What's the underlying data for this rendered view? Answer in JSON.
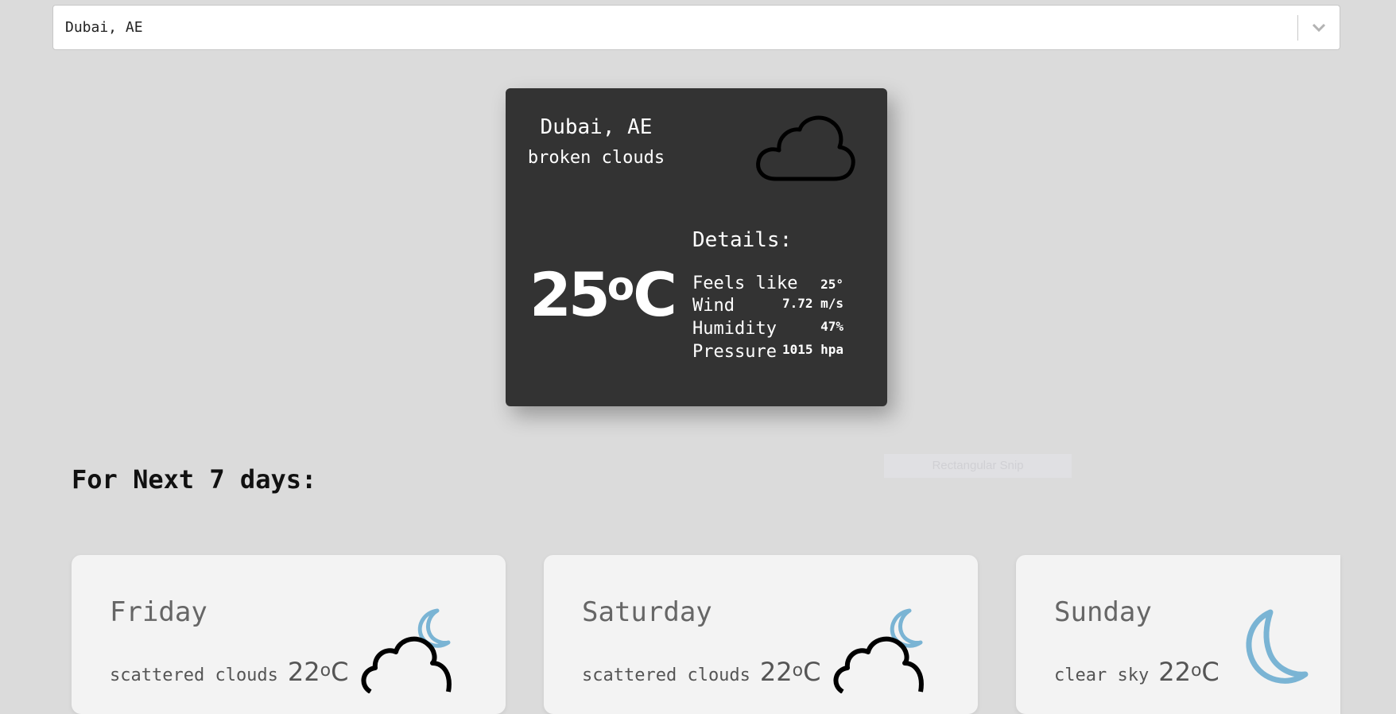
{
  "search": {
    "value": "Dubai, AE"
  },
  "current": {
    "city": "Dubai, AE",
    "description": "broken clouds",
    "temperature": "25",
    "temp_degree": "o",
    "temp_unit": "C",
    "icon": "cloud-icon",
    "details_title": "Details:",
    "details": [
      {
        "label": "Feels like",
        "value": "25°"
      },
      {
        "label": "Wind",
        "value": "7.72 m/s"
      },
      {
        "label": "Humidity",
        "value": "47%"
      },
      {
        "label": "Pressure",
        "value": "1015 hpa"
      }
    ]
  },
  "forecast": {
    "title": "For Next 7 days:",
    "days": [
      {
        "day": "Friday",
        "description": "scattered clouds",
        "temperature": "22",
        "degree": "o",
        "unit": "C",
        "icon": "cloud-moon-icon"
      },
      {
        "day": "Saturday",
        "description": "scattered clouds",
        "temperature": "22",
        "degree": "o",
        "unit": "C",
        "icon": "cloud-moon-icon"
      },
      {
        "day": "Sunday",
        "description": "clear sky",
        "temperature": "22",
        "degree": "o",
        "unit": "C",
        "icon": "moon-icon"
      }
    ]
  },
  "overlay": {
    "snip_label": "Rectangular Snip"
  },
  "colors": {
    "background": "#dbdbdb",
    "card_dark": "#333333",
    "card_light": "#f3f3f3",
    "moon_blue": "#7ab4d4"
  }
}
